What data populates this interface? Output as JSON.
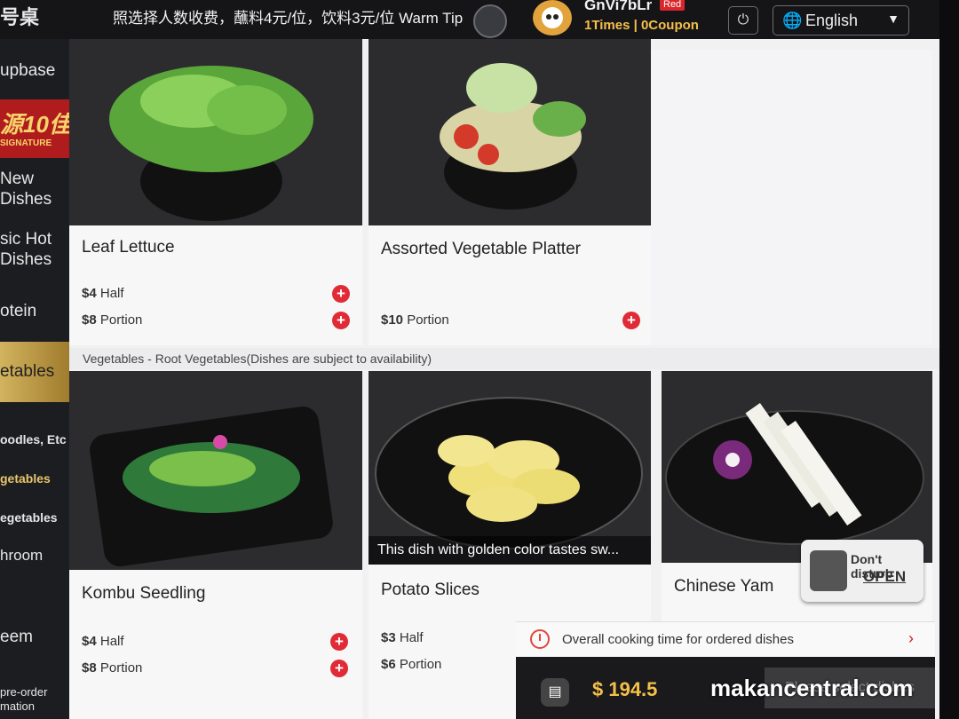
{
  "topbar": {
    "table_no": "号桌",
    "notice": "照选择人数收费，蘸料4元/位，饮料3元/位 Warm Tip",
    "user_id": "GnVi7bLr",
    "badge": "Red",
    "stats": "1Times | 0Coupon",
    "language": "English",
    "icons": [
      "power-icon",
      "globe-icon",
      "chevron-down-icon"
    ]
  },
  "sidebar": {
    "items": [
      {
        "label": "upbase"
      },
      {
        "label": "New\nDishes"
      },
      {
        "label": "sic Hot\nDishes"
      },
      {
        "label": "otein"
      },
      {
        "label": "etables"
      },
      {
        "label": "oodles, Etc"
      },
      {
        "label": "getables"
      },
      {
        "label": "egetables"
      },
      {
        "label": "hroom"
      },
      {
        "label": "eem"
      },
      {
        "label": "pre-order\nmation"
      }
    ],
    "signature": {
      "big": "源10佳",
      "sub": "SIGNATURE"
    }
  },
  "section": {
    "header": "Vegetables - Root Vegetables(Dishes are subject to availability)"
  },
  "dishes": [
    {
      "name": "Leaf Lettuce",
      "prices": [
        {
          "price": "$4",
          "unit": "Half"
        },
        {
          "price": "$8",
          "unit": "Portion"
        }
      ]
    },
    {
      "name": "Assorted Vegetable Platter",
      "prices": [
        {
          "price": "$10",
          "unit": "Portion"
        }
      ]
    },
    {
      "name": "Kombu Seedling",
      "prices": [
        {
          "price": "$4",
          "unit": "Half"
        },
        {
          "price": "$8",
          "unit": "Portion"
        }
      ]
    },
    {
      "name": "Potato Slices",
      "desc": "This dish with golden color tastes sw...",
      "prices": [
        {
          "price": "$3",
          "unit": "Half"
        },
        {
          "price": "$6",
          "unit": "Portion"
        }
      ]
    },
    {
      "name": "Chinese Yam",
      "prices": []
    }
  ],
  "dnd": {
    "line1": "Don't disturb",
    "line2": "OPEN"
  },
  "cooking": {
    "label": "Overall cooking time for ordered dishes"
  },
  "cart": {
    "total": "$ 194.5",
    "select_label": "Please select dishes"
  },
  "watermark": "makancentral.com"
}
